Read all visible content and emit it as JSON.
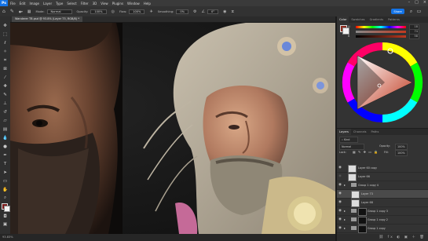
{
  "app": {
    "logo": "Ps"
  },
  "menu": {
    "items": [
      "File",
      "Edit",
      "Image",
      "Layer",
      "Type",
      "Select",
      "Filter",
      "3D",
      "View",
      "Plugins",
      "Window",
      "Help"
    ]
  },
  "window_controls": [
    "–",
    "□",
    "×"
  ],
  "options_bar": {
    "mode_label": "Mode:",
    "mode_value": "Normal",
    "opacity_label": "Opacity:",
    "opacity_value": "100%",
    "flow_label": "Flow:",
    "flow_value": "100%",
    "smoothing_label": "Smoothing:",
    "smoothing_value": "0%",
    "angle_value": "0°",
    "share_label": "Share"
  },
  "document_tab": {
    "title": "Wanderer TB.psd @ 93.8% (Layer 73, RGB/8) *"
  },
  "status_bar": {
    "zoom": "93.83%"
  },
  "color_panel": {
    "tabs": [
      "Color",
      "Swatches",
      "Gradients",
      "Patterns"
    ],
    "channels": [
      {
        "label": "H",
        "value": "18"
      },
      {
        "label": "S",
        "value": "74"
      },
      {
        "label": "B",
        "value": "58"
      }
    ],
    "foreground_color": "#8e2a1e",
    "background_color": "#f2f2f2"
  },
  "layers_panel": {
    "tabs": [
      "Layers",
      "Channels",
      "Paths"
    ],
    "kind_label": "Kind",
    "blend_mode": "Normal",
    "opacity_label": "Opacity:",
    "opacity_value": "100%",
    "lock_label": "Lock:",
    "fill_label": "Fill:",
    "fill_value": "100%",
    "layers": [
      {
        "name": "Layer 60 copy",
        "type": "pixel",
        "visible": true
      },
      {
        "name": "Layer 66",
        "type": "pixel",
        "visible": false
      },
      {
        "name": "Group 1 copy 4",
        "type": "group",
        "visible": true
      },
      {
        "name": "Layer 73",
        "type": "pixel",
        "visible": true,
        "selected": true
      },
      {
        "name": "Layer 68",
        "type": "pixel",
        "visible": true
      },
      {
        "name": "Group 1 copy 3",
        "type": "group",
        "visible": true
      },
      {
        "name": "Group 1 copy 2",
        "type": "group",
        "visible": true
      },
      {
        "name": "Group 1 copy",
        "type": "group",
        "visible": true
      }
    ]
  }
}
